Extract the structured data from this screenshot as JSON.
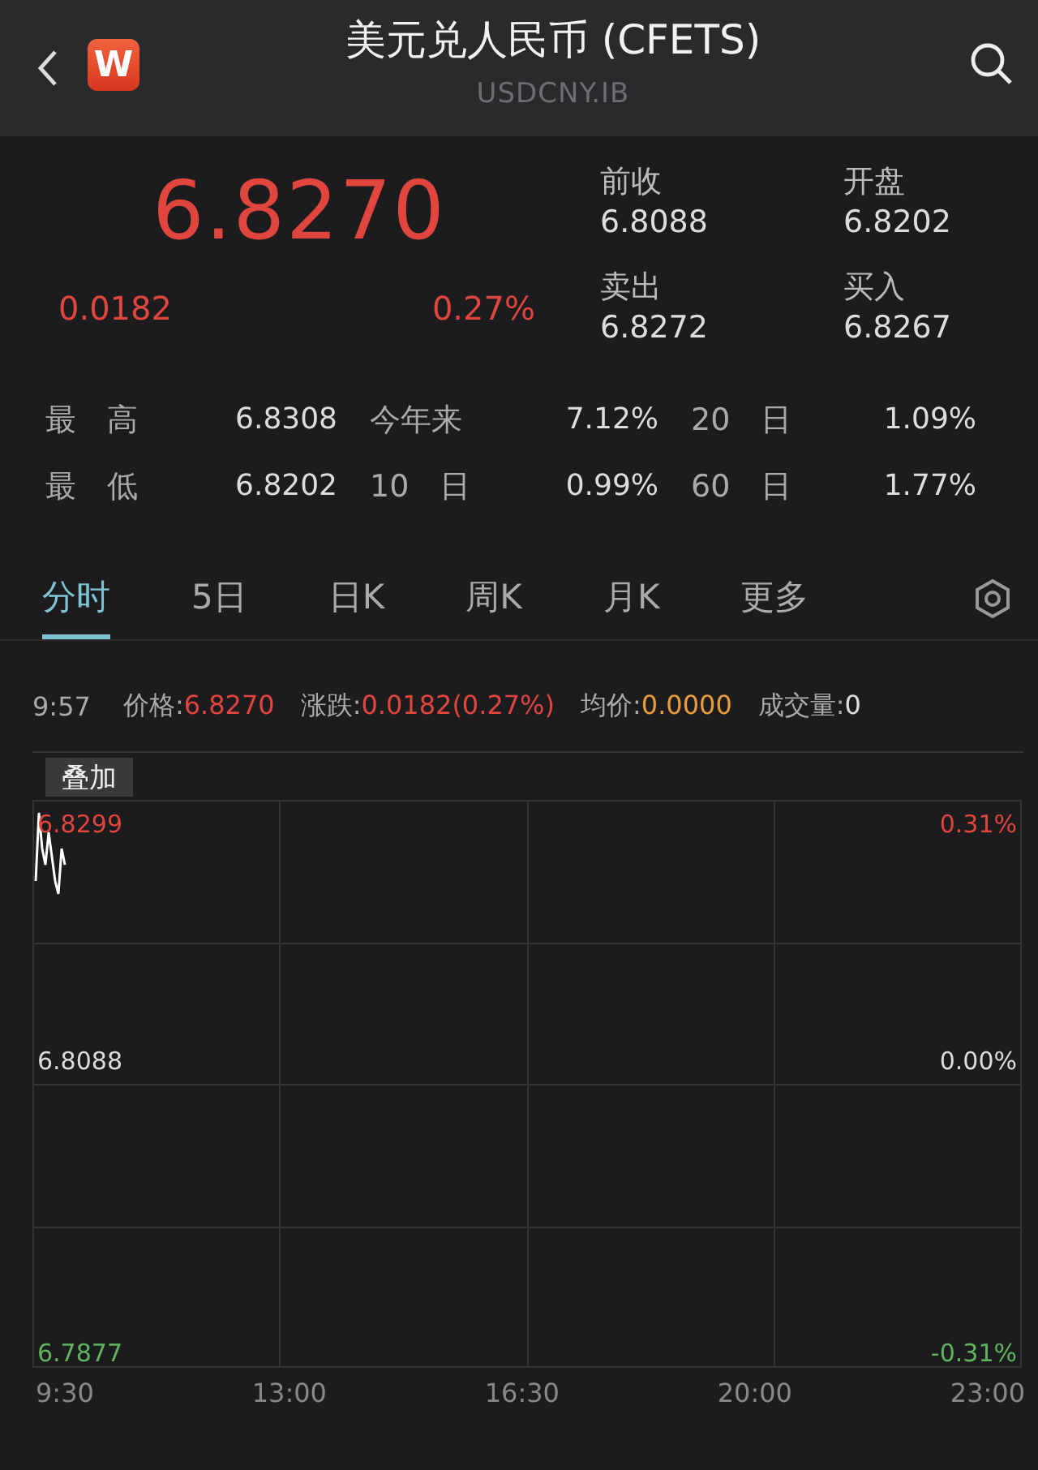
{
  "header": {
    "title": "美元兑人民币 (CFETS)",
    "subtitle": "USDCNY.IB",
    "logo": "W"
  },
  "quote": {
    "price": "6.8270",
    "change": "0.0182",
    "change_pct": "0.27%",
    "fields": [
      {
        "label": "前收",
        "value": "6.8088"
      },
      {
        "label": "开盘",
        "value": "6.8202"
      },
      {
        "label": "卖出",
        "value": "6.8272"
      },
      {
        "label": "买入",
        "value": "6.8267"
      }
    ]
  },
  "stats": [
    {
      "label": "最　高",
      "value": "6.8308"
    },
    {
      "label": "今年来",
      "value": "7.12%"
    },
    {
      "label": "20　日",
      "value": "1.09%"
    },
    {
      "label": "最　低",
      "value": "6.8202"
    },
    {
      "label": "10　日",
      "value": "0.99%"
    },
    {
      "label": "60　日",
      "value": "1.77%"
    }
  ],
  "tabs": [
    {
      "label": "分时",
      "selected": true
    },
    {
      "label": "5日",
      "selected": false
    },
    {
      "label": "日K",
      "selected": false
    },
    {
      "label": "周K",
      "selected": false
    },
    {
      "label": "月K",
      "selected": false
    },
    {
      "label": "更多",
      "selected": false
    }
  ],
  "info": {
    "time": "9:57",
    "items": [
      {
        "label": "价格:",
        "value": "6.8270",
        "kind": "up"
      },
      {
        "label": "涨跌:",
        "value": "0.0182(0.27%)",
        "kind": "up"
      },
      {
        "label": "均价:",
        "value": "0.0000",
        "kind": "avg"
      },
      {
        "label": "成交量:",
        "value": "0",
        "kind": "plain"
      }
    ]
  },
  "chart": {
    "overlay_button": "叠加",
    "left_labels": [
      {
        "text": "6.8299",
        "kind": "up"
      },
      {
        "text": "6.8088",
        "kind": "flat"
      },
      {
        "text": "6.7877",
        "kind": "down"
      }
    ],
    "right_labels": [
      {
        "text": "0.31%",
        "kind": "up"
      },
      {
        "text": "0.00%",
        "kind": "flat"
      },
      {
        "text": "-0.31%",
        "kind": "down"
      }
    ],
    "x_labels": [
      "9:30",
      "13:00",
      "16:30",
      "20:00",
      "23:00"
    ]
  }
}
